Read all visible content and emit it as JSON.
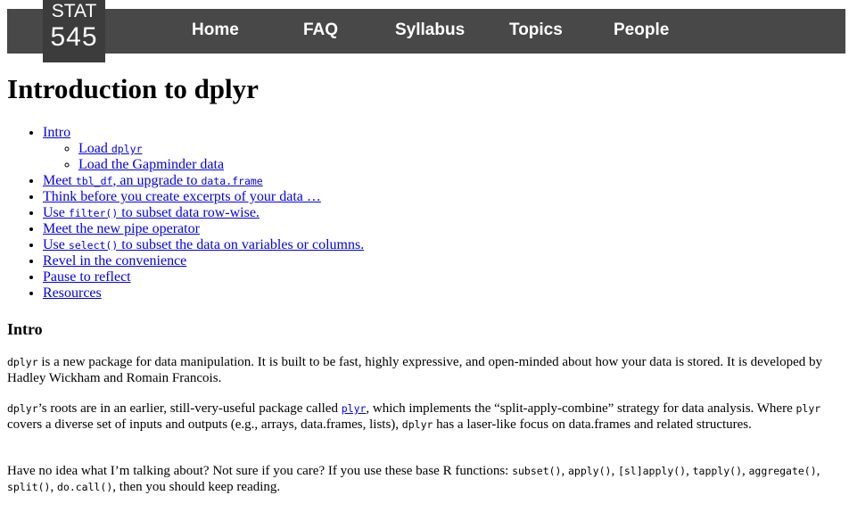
{
  "logo": {
    "line1": "STAT",
    "line2": "545"
  },
  "nav": [
    "Home",
    "FAQ",
    "Syllabus",
    "Topics",
    "People"
  ],
  "title": "Introduction to dplyr",
  "toc": {
    "intro": "Intro",
    "load_pre": "Load ",
    "load_code": "dplyr",
    "load_gap": "Load the Gapminder data",
    "meet_pre": "Meet ",
    "meet_code1": "tbl_df",
    "meet_mid": ", an upgrade to ",
    "meet_code2": "data.frame",
    "think": "Think before you create excerpts of your data …",
    "filter_pre": "Use ",
    "filter_code": "filter()",
    "filter_post": " to subset data row-wise.",
    "pipe": "Meet the new pipe operator",
    "select_pre": "Use ",
    "select_code": "select()",
    "select_post": " to subset the data on variables or columns.",
    "revel": "Revel in the convenience",
    "pause": "Pause to reflect",
    "resources": "Resources"
  },
  "intro_heading": "Intro",
  "p1": {
    "code": "dplyr",
    "text": " is a new package for data manipulation. It is built to be fast, highly expressive, and open-minded about how your data is stored. It is developed by Hadley Wickham and Romain Francois."
  },
  "p2": {
    "code1": "dplyr",
    "t1": "’s roots are in an earlier, still-very-useful package called ",
    "link": "plyr",
    "t2": ", which implements the “split-apply-combine” strategy for data analysis. Where ",
    "code2": "plyr",
    "t3": " covers a diverse set of inputs and outputs (e.g., arrays, data.frames, lists), ",
    "code3": "dplyr",
    "t4": " has a laser-like focus on data.frames and related structures."
  },
  "p3": {
    "t1": "Have no idea what I’m talking about? Not sure if you care? If you use these base R functions: ",
    "f1": "subset()",
    "f2": "apply()",
    "f3": "[sl]apply()",
    "f4": "tapply()",
    "f5": "aggregate()",
    "f6": "split()",
    "f7": "do.call()",
    "t2": ", then you should keep reading.",
    "sep": ", "
  }
}
